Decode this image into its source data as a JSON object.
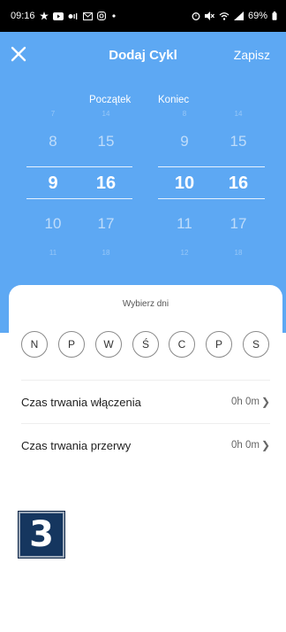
{
  "status_bar": {
    "time": "09:16",
    "battery": "69%",
    "icons_left": [
      "star-icon",
      "video-icon",
      "volte-icon",
      "mail-icon",
      "instagram-icon",
      "dot-icon"
    ],
    "icons_right": [
      "alarm-icon",
      "mute-icon",
      "wifi-icon",
      "signal-icon",
      "battery-icon"
    ]
  },
  "header": {
    "title": "Dodaj Cykl",
    "save_label": "Zapisz",
    "close_icon": "close-icon"
  },
  "picker": {
    "start_label": "Początek",
    "end_label": "Koniec",
    "start": {
      "hours": [
        "7",
        "8",
        "9",
        "10",
        "11"
      ],
      "minutes": [
        "14",
        "15",
        "16",
        "17",
        "18"
      ],
      "selected_hour": "9",
      "selected_minute": "16"
    },
    "end": {
      "hours": [
        "8",
        "9",
        "10",
        "11",
        "12"
      ],
      "minutes": [
        "14",
        "15",
        "16",
        "17",
        "18"
      ],
      "selected_hour": "10",
      "selected_minute": "16"
    }
  },
  "sheet": {
    "title": "Wybierz dni",
    "days": [
      "N",
      "P",
      "W",
      "Ś",
      "C",
      "P",
      "S"
    ],
    "rows": [
      {
        "label": "Czas trwania włączenia",
        "value": "0h 0m"
      },
      {
        "label": "Czas trwania przerwy",
        "value": "0h 0m"
      }
    ]
  },
  "badge": {
    "text": "3"
  },
  "colors": {
    "header_bg": "#5da8f3",
    "badge_bg": "#15365f"
  }
}
